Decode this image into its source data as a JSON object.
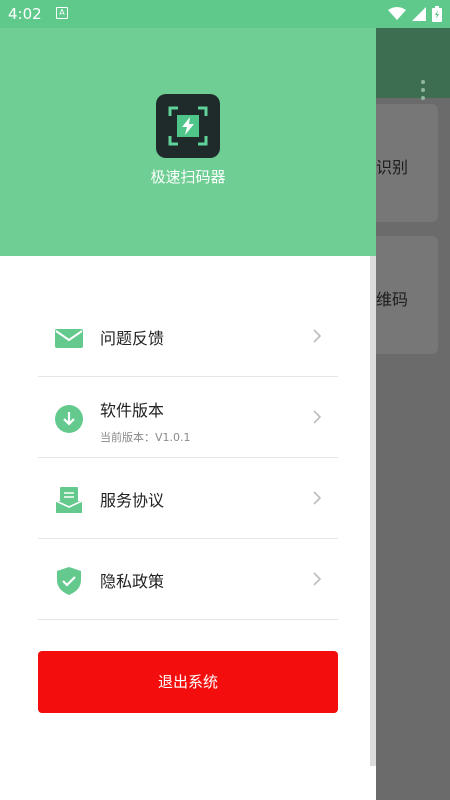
{
  "status_bar": {
    "time": "4:02",
    "notification_glyph": "A"
  },
  "background_app": {
    "card1_text": "识别",
    "card2_text": "维码"
  },
  "drawer": {
    "app_name": "极速扫码器",
    "menu_items": [
      {
        "label": "问题反馈",
        "sub": "",
        "icon": "mail-icon"
      },
      {
        "label": "软件版本",
        "sub": "当前版本：V1.0.1",
        "icon": "download-icon"
      },
      {
        "label": "服务协议",
        "sub": "",
        "icon": "document-icon"
      },
      {
        "label": "隐私政策",
        "sub": "",
        "icon": "shield-check-icon"
      }
    ],
    "logout_label": "退出系统"
  },
  "colors": {
    "header_green": "#6fce94",
    "icon_green": "#63c98d",
    "logout_red": "#f40d0d"
  }
}
